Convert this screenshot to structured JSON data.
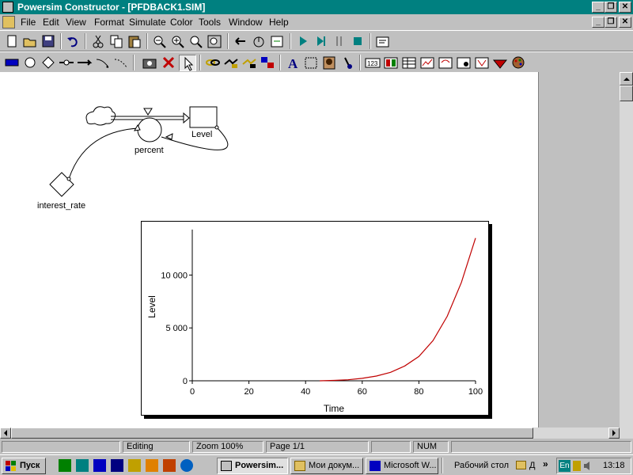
{
  "window": {
    "title": "Powersim Constructor - [PFDBACK1.SIM]",
    "controls": [
      "_",
      "❐",
      "✕"
    ]
  },
  "menu": [
    "File",
    "Edit",
    "View",
    "Format",
    "Simulate",
    "Color",
    "Tools",
    "Window",
    "Help"
  ],
  "model": {
    "level_label": "Level",
    "flow_label": "percent",
    "aux_label": "interest_rate"
  },
  "chart_data": {
    "type": "line",
    "xlabel": "Time",
    "ylabel": "Level",
    "xlim": [
      0,
      100
    ],
    "ylim": [
      0,
      14000
    ],
    "x_ticks": [
      0,
      20,
      40,
      60,
      80,
      100
    ],
    "y_ticks": [
      0,
      5000,
      10000
    ],
    "y_tick_labels": [
      "0",
      "5 000",
      "10 000"
    ],
    "x_tick_labels": [
      "0",
      "20",
      "40",
      "60",
      "80",
      "100"
    ],
    "line_color": "#c00000",
    "series": [
      {
        "x": [
          45,
          50,
          55,
          60,
          65,
          70,
          75,
          80,
          85,
          90,
          95,
          100
        ],
        "values": [
          0,
          40,
          100,
          230,
          450,
          800,
          1400,
          2300,
          3800,
          6100,
          9300,
          13500
        ]
      }
    ]
  },
  "status": {
    "mode": "Editing",
    "zoom": "Zoom 100%",
    "page": "Page  1/1",
    "num": "NUM"
  },
  "taskbar": {
    "start": "Пуск",
    "tasks": [
      "Powersim...",
      "Мои докум...",
      "Microsoft W..."
    ],
    "desktop": "Рабочий стол",
    "folder": "Д",
    "lang": "En",
    "clock": "13:18"
  },
  "colors": {
    "titlebar": "#008080",
    "face": "#c0c0c0",
    "curve": "#c00000"
  },
  "toolbar1_icons": [
    "new-icon",
    "open-icon",
    "save-icon",
    "undo-icon",
    "cut-icon",
    "copy-icon",
    "paste-icon",
    "zoom-out-icon",
    "zoom-in-icon",
    "zoom-icon",
    "zoom-fit-icon",
    "step-back-icon",
    "reset-icon",
    "step-icon",
    "play-icon",
    "step-forward-icon",
    "pause-icon",
    "stop-icon",
    "properties-icon"
  ],
  "toolbar2_icons": [
    "level-tool-icon",
    "auxiliary-tool-icon",
    "constant-tool-icon",
    "flow-tool-icon",
    "flow-with-rate-icon",
    "link-tool-icon",
    "delayed-link-icon",
    "snapshot-icon",
    "delete-icon",
    "pointer-icon",
    "chain-icon",
    "loop-icon",
    "loop2-icon",
    "network-icon",
    "text-tool-icon",
    "frame-tool-icon",
    "picture-tool-icon",
    "probe-icon",
    "number-icon",
    "slider-icon",
    "table-icon",
    "time-graph-icon",
    "scatter-icon",
    "switch-icon",
    "dataset-icon",
    "diamond-icon",
    "palette-icon"
  ]
}
